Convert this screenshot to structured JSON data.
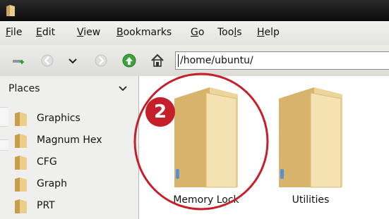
{
  "menubar": {
    "items": [
      {
        "mnemonic": "F",
        "rest": "ile"
      },
      {
        "mnemonic": "E",
        "rest": "dit"
      },
      {
        "mnemonic": "V",
        "rest": "iew"
      },
      {
        "mnemonic": "B",
        "rest": "ookmarks"
      },
      {
        "mnemonic": "G",
        "rest": "o"
      },
      {
        "pre": "Too",
        "mnemonic": "l",
        "rest": "s"
      },
      {
        "mnemonic": "H",
        "rest": "elp"
      }
    ]
  },
  "toolbar": {
    "location_path": "/home/ubuntu/",
    "icons": [
      "new-tab-icon",
      "back-icon",
      "history-dropdown-icon",
      "forward-icon",
      "up-icon",
      "home-icon"
    ]
  },
  "sidebar": {
    "header": "Places",
    "items": [
      {
        "label": "Graphics"
      },
      {
        "label": "Magnum Hex"
      },
      {
        "label": "CFG"
      },
      {
        "label": "Graph"
      },
      {
        "label": "PRT"
      }
    ]
  },
  "main": {
    "folders": [
      {
        "name": "Memory Lock"
      },
      {
        "name": "Utilities"
      }
    ]
  },
  "annotation": {
    "badge_number": "2",
    "color": "#c41f2b"
  }
}
